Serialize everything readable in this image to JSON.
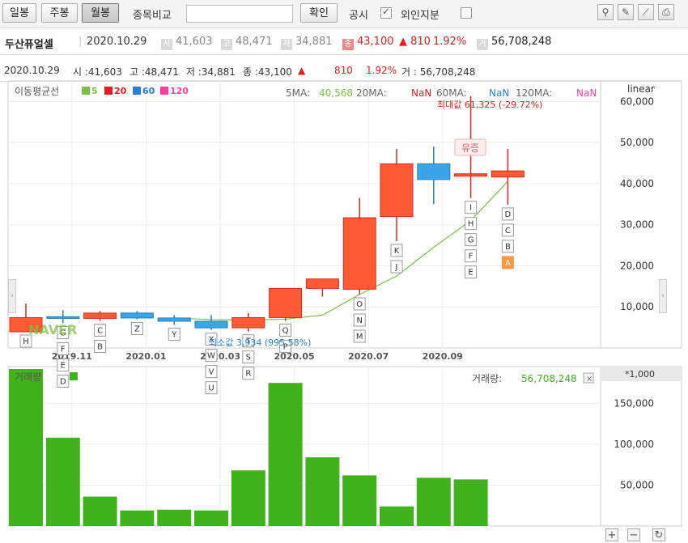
{
  "toolbar": {
    "daily": "일봉",
    "weekly": "주봉",
    "monthly": "월봉",
    "compare_label": "종목비교",
    "compare_value": "",
    "confirm": "확인",
    "disclosure": "공시",
    "foreign": "외인지분"
  },
  "info": {
    "name": "두산퓨얼셀",
    "date": "2020.10.29",
    "open_tag": "시",
    "open": "41,603",
    "high_tag": "고",
    "high": "48,471",
    "low_tag": "저",
    "low": "34,881",
    "close_tag": "종",
    "close": "43,100",
    "change": "▲ 810",
    "change_pct": "1.92%",
    "volume_tag": "거",
    "volume": "56,708,248"
  },
  "chart_info": {
    "date": "2020.10.29",
    "open": "시 :41,603",
    "high": "고 :48,471",
    "low": "저 :34,881",
    "close": "종 :43,100",
    "arrow": "▲",
    "change": "810",
    "pct": "1.92%",
    "volume": "거 : 56,708,248"
  },
  "legend": {
    "ma_label": "이동평균선",
    "ma5": "5",
    "ma20": "20",
    "ma60": "60",
    "ma120": "120",
    "ma5_text": "5MA:",
    "ma5_val": "40,568",
    "ma20_text": "20MA:",
    "ma20_val": "NaN",
    "ma60_text": "60MA:",
    "ma60_val": "NaN",
    "ma120_text": "120MA:",
    "ma120_val": "NaN",
    "scale": "linear",
    "max_note": "최대값 61,325 (-29.72%)",
    "min_note": "최소값 3,934 (995.58%)",
    "badge": "유증",
    "watermark": "NAVER",
    "volume_label": "거래량",
    "volume_text": "거래량:",
    "volume_val": "56,708,248",
    "volume_unit": "*1,000"
  },
  "colors": {
    "up": "#ff5a36",
    "down": "#3aa6e8",
    "ma5": "#7bc043",
    "ma20": "#e02020",
    "ma60": "#2a7fd8",
    "ma120": "#ff3fa0",
    "volume": "#3fb21c"
  },
  "chart_data": [
    {
      "type": "candlestick",
      "ylim": [
        0,
        65000
      ],
      "y_ticks": [
        10000,
        20000,
        30000,
        40000,
        50000,
        60000
      ],
      "y_tick_labels": [
        "10,000",
        "20,000",
        "30,000",
        "40,000",
        "50,000",
        "60,000"
      ],
      "x_labels": [
        "2019.11",
        "2020.01",
        "2020.03",
        "2020.05",
        "2020.07",
        "2020.09"
      ],
      "candles": [
        {
          "open": 3934,
          "high": 10800,
          "low": 3934,
          "close": 7400
        },
        {
          "open": 7600,
          "high": 9200,
          "low": 6000,
          "close": 7200
        },
        {
          "open": 7200,
          "high": 9000,
          "low": 6600,
          "close": 8500
        },
        {
          "open": 8500,
          "high": 9000,
          "low": 7000,
          "close": 7300
        },
        {
          "open": 7300,
          "high": 8000,
          "low": 5600,
          "close": 6500
        },
        {
          "open": 6500,
          "high": 8000,
          "low": 4400,
          "close": 4900
        },
        {
          "open": 4900,
          "high": 8500,
          "low": 4000,
          "close": 7400
        },
        {
          "open": 7400,
          "high": 14000,
          "low": 6600,
          "close": 14500
        },
        {
          "open": 14500,
          "high": 16800,
          "low": 12500,
          "close": 16800
        },
        {
          "open": 14300,
          "high": 36500,
          "low": 13000,
          "close": 31700
        },
        {
          "open": 32000,
          "high": 48500,
          "low": 26000,
          "close": 44800
        },
        {
          "open": 44800,
          "high": 49000,
          "low": 35000,
          "close": 41000
        },
        {
          "open": 41800,
          "high": 61325,
          "low": 36500,
          "close": 42400
        },
        {
          "open": 41603,
          "high": 48471,
          "low": 34881,
          "close": 43100
        }
      ],
      "ma5": [
        null,
        null,
        null,
        null,
        7300,
        6900,
        6800,
        7000,
        8000,
        13000,
        17500,
        24500,
        31000,
        40568
      ],
      "markers_below": [
        [
          "H"
        ],
        [
          "G",
          "F",
          "E",
          "D"
        ],
        [
          "C",
          "B"
        ],
        [
          "Z"
        ],
        [
          "Y"
        ],
        [
          "X",
          "W",
          "V",
          "U"
        ],
        [
          "T",
          "S",
          "R"
        ],
        [
          "Q",
          "P"
        ],
        [],
        [
          "O",
          "N",
          "M"
        ],
        [
          "K",
          "J"
        ],
        [],
        [
          "I",
          "H",
          "G",
          "F",
          "E"
        ],
        [
          "D",
          "C",
          "B",
          "A"
        ]
      ]
    },
    {
      "type": "bar",
      "title": "거래량",
      "unit": "*1,000",
      "ylim": [
        0,
        195000
      ],
      "y_ticks": [
        50000,
        100000,
        150000
      ],
      "y_tick_labels": [
        "50,000",
        "100,000",
        "150,000"
      ],
      "values": [
        192000,
        108000,
        36000,
        19000,
        20000,
        19000,
        68000,
        175000,
        84000,
        62000,
        24000,
        59000,
        57000
      ]
    }
  ]
}
